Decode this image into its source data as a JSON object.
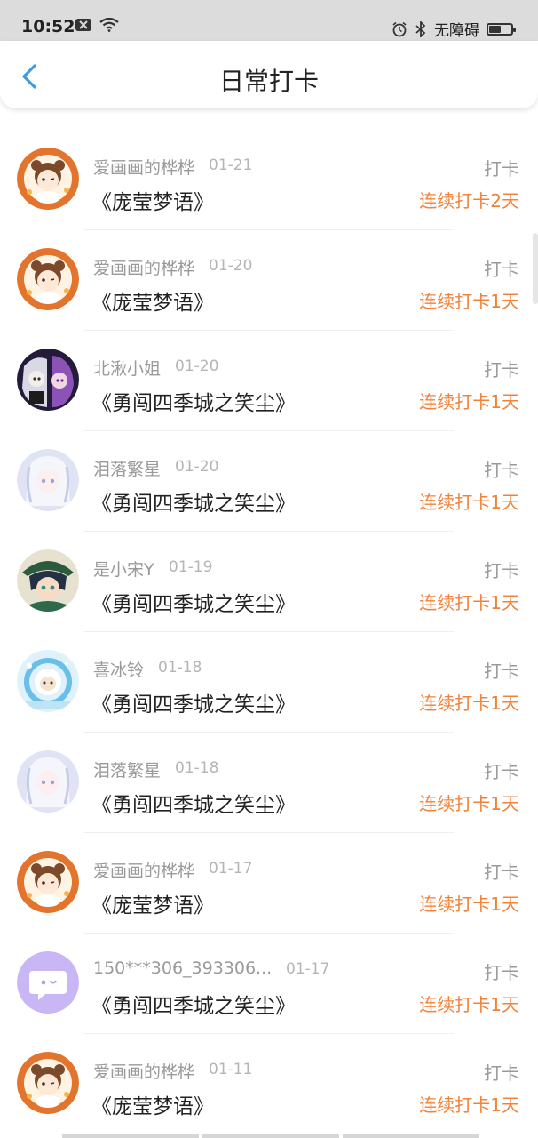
{
  "status_bar": {
    "time": "10:52",
    "accessibility": "无障碍",
    "battery_level": 0.55,
    "icons": [
      "notification-x-icon",
      "wifi-icon",
      "alarm-icon",
      "bluetooth-icon",
      "battery-icon"
    ]
  },
  "header": {
    "title": "日常打卡",
    "back_icon": "chevron-left-icon",
    "accent": "#3a9be8"
  },
  "colors": {
    "streak": "#f0823a",
    "muted": "#9a9a9a"
  },
  "checkins": [
    {
      "user": "爱画画的桦桦",
      "date": "01-21",
      "book": "《庞莹梦语》",
      "action": "打卡",
      "streak": "连续打卡2天",
      "avatar": "cat-girl"
    },
    {
      "user": "爱画画的桦桦",
      "date": "01-20",
      "book": "《庞莹梦语》",
      "action": "打卡",
      "streak": "连续打卡1天",
      "avatar": "cat-girl"
    },
    {
      "user": "北湫小姐",
      "date": "01-20",
      "book": "《勇闯四季城之笑尘》",
      "action": "打卡",
      "streak": "连续打卡1天",
      "avatar": "purple-duo"
    },
    {
      "user": "泪落繁星",
      "date": "01-20",
      "book": "《勇闯四季城之笑尘》",
      "action": "打卡",
      "streak": "连续打卡1天",
      "avatar": "white-hair"
    },
    {
      "user": "是小宋Y",
      "date": "01-19",
      "book": "《勇闯四季城之笑尘》",
      "action": "打卡",
      "streak": "连续打卡1天",
      "avatar": "green-boy"
    },
    {
      "user": "喜冰铃",
      "date": "01-18",
      "book": "《勇闯四季城之笑尘》",
      "action": "打卡",
      "streak": "连续打卡1天",
      "avatar": "blue-circle"
    },
    {
      "user": "泪落繁星",
      "date": "01-18",
      "book": "《勇闯四季城之笑尘》",
      "action": "打卡",
      "streak": "连续打卡1天",
      "avatar": "white-hair"
    },
    {
      "user": "爱画画的桦桦",
      "date": "01-17",
      "book": "《庞莹梦语》",
      "action": "打卡",
      "streak": "连续打卡1天",
      "avatar": "cat-girl"
    },
    {
      "user": "150***306_393306...",
      "date": "01-17",
      "book": "《勇闯四季城之笑尘》",
      "action": "打卡",
      "streak": "连续打卡1天",
      "avatar": "chat-default"
    },
    {
      "user": "爱画画的桦桦",
      "date": "01-11",
      "book": "《庞莹梦语》",
      "action": "打卡",
      "streak": "连续打卡1天",
      "avatar": "cat-girl"
    }
  ]
}
